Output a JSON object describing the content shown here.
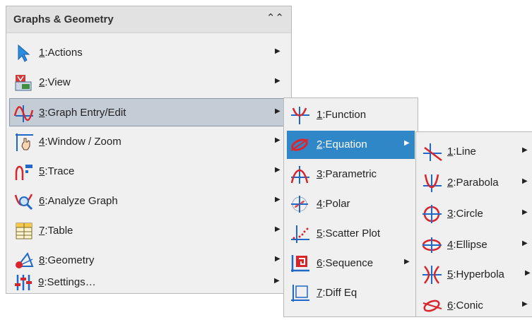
{
  "menu1": {
    "title": "Graphs & Geometry",
    "collapse_glyph": "≈",
    "items": [
      {
        "key": "1",
        "label": "Actions",
        "icon": "pointer-arrow-icon"
      },
      {
        "key": "2",
        "label": "View",
        "icon": "view-icon"
      },
      {
        "key": "3",
        "label": "Graph Entry/Edit",
        "icon": "graph-entry-icon"
      },
      {
        "key": "4",
        "label": "Window / Zoom",
        "icon": "window-zoom-icon"
      },
      {
        "key": "5",
        "label": "Trace",
        "icon": "trace-icon"
      },
      {
        "key": "6",
        "label": "Analyze Graph",
        "icon": "analyze-graph-icon"
      },
      {
        "key": "7",
        "label": "Table",
        "icon": "table-icon"
      },
      {
        "key": "8",
        "label": "Geometry",
        "icon": "geometry-icon"
      },
      {
        "key": "9",
        "label": "Settings…",
        "icon": "settings-icon"
      }
    ]
  },
  "menu2": {
    "items": [
      {
        "key": "1",
        "label": "Function",
        "icon": "function-icon",
        "has_submenu": false
      },
      {
        "key": "2",
        "label": "Equation",
        "icon": "equation-icon",
        "has_submenu": true
      },
      {
        "key": "3",
        "label": "Parametric",
        "icon": "parametric-icon",
        "has_submenu": false
      },
      {
        "key": "4",
        "label": "Polar",
        "icon": "polar-icon",
        "has_submenu": false
      },
      {
        "key": "5",
        "label": "Scatter Plot",
        "icon": "scatter-plot-icon",
        "has_submenu": false
      },
      {
        "key": "6",
        "label": "Sequence",
        "icon": "sequence-icon",
        "has_submenu": true
      },
      {
        "key": "7",
        "label": "Diff Eq",
        "icon": "diff-eq-icon",
        "has_submenu": false
      }
    ]
  },
  "menu3": {
    "items": [
      {
        "key": "1",
        "label": "Line",
        "icon": "line-icon"
      },
      {
        "key": "2",
        "label": "Parabola",
        "icon": "parabola-icon"
      },
      {
        "key": "3",
        "label": "Circle",
        "icon": "circle-icon"
      },
      {
        "key": "4",
        "label": "Ellipse",
        "icon": "ellipse-icon"
      },
      {
        "key": "5",
        "label": "Hyperbola",
        "icon": "hyperbola-icon"
      },
      {
        "key": "6",
        "label": "Conic",
        "icon": "conic-icon"
      }
    ]
  },
  "colors": {
    "accent_blue": "#2f87c8",
    "icon_red": "#e0242b",
    "icon_blue": "#2a6fd6"
  }
}
